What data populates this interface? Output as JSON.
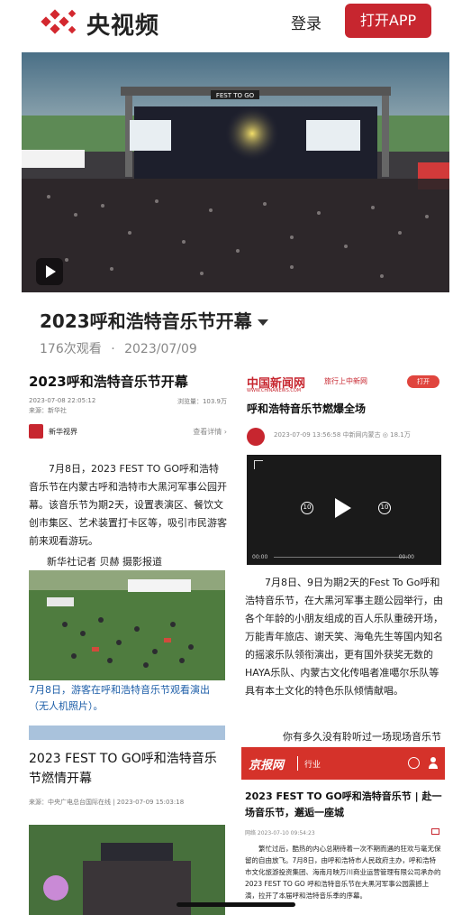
{
  "header": {
    "logo_text": "央视频",
    "login_label": "登录",
    "open_app_label": "打开APP",
    "brand_color": "#c7262f"
  },
  "video": {
    "stage_label": "FEST TO GO",
    "title": "2023呼和浩特音乐节开幕",
    "views": "176次观看",
    "separator": "·",
    "date": "2023/07/09"
  },
  "left_article": {
    "title": "2023呼和浩特音乐节开幕",
    "datetime": "2023-07-08 22:05:12",
    "views": "浏览量：103.9万",
    "source": "来源：新华社",
    "author": "新华视界",
    "author_icon_text": "新华\n视界",
    "detail_link": "查看详情 ›",
    "paragraph": "7月8日，2023 FEST TO GO呼和浩特音乐节在内蒙古呼和浩特市大黑河军事公园开幕。该音乐节为期2天，设置表演区、餐饮文创市集区、艺术装置打卡区等，吸引市民游客前来观看游玩。",
    "reporter": "新华社记者 贝赫 摄影报道",
    "caption": "7月8日，游客在呼和浩特音乐节观看演出（无人机照片）。",
    "title2": "2023 FEST TO GO呼和浩特音乐节燃情开幕",
    "source2": "来源：中央广电总台国际在线 | 2023-07-09 15:03:18"
  },
  "right_article": {
    "brand": "中国新闻网",
    "brand_sub": "WWW.CHINANEWS.COM",
    "brand2": "旅行上中新网",
    "open_label": "打开",
    "title": "呼和浩特音乐节燃爆全场",
    "meta": "2023-07-09 13:56:58 中新网内蒙古   ◎ 18.1万",
    "video_time_start": "00:00",
    "video_time_end": "00:00",
    "rewind_label": "10",
    "forward_label": "10",
    "paragraph": "7月8日、9日为期2天的Fest To Go呼和浩特音乐节，在大黑河军事主题公园举行，由各个年龄的小朋友组成的百人乐队重磅开场，万能青年旅店、谢天笑、海龟先生等国内知名的摇滚乐队领衔演出，更有国外获奖无数的HAYA乐队、内蒙古文化传唱者准噶尔乐队等具有本土文化的特色乐队倾情献唱。",
    "more_line": "你有多久没有聆听过一场现场音乐节",
    "jingbao": {
      "logo": "京报网",
      "category": "行业",
      "title": "2023 FEST TO GO呼和浩特音乐节 | 赴一场音乐节，邂逅一座城",
      "meta": "网络  2023-07-10 09:54:23",
      "paragraph": "繁忙过后，酷热的内心总期待着一次不期而遇的狂欢与毫无保留的自由放飞。7月8日，由呼和浩特市人民政府主办，呼和浩特市文化旅游投资集团、海南月映万川商业运营管理有限公司承办的2023 FEST TO GO 呼和浩特音乐节在大黑河军事公园震撼上演，拉开了本届呼和浩特音乐季的序幕。"
    }
  },
  "icons": [
    "logo-icon",
    "play-icon",
    "caret-down-icon",
    "rewind-10-icon",
    "forward-10-icon",
    "expand-icon",
    "search-icon",
    "user-icon",
    "image-icon"
  ]
}
